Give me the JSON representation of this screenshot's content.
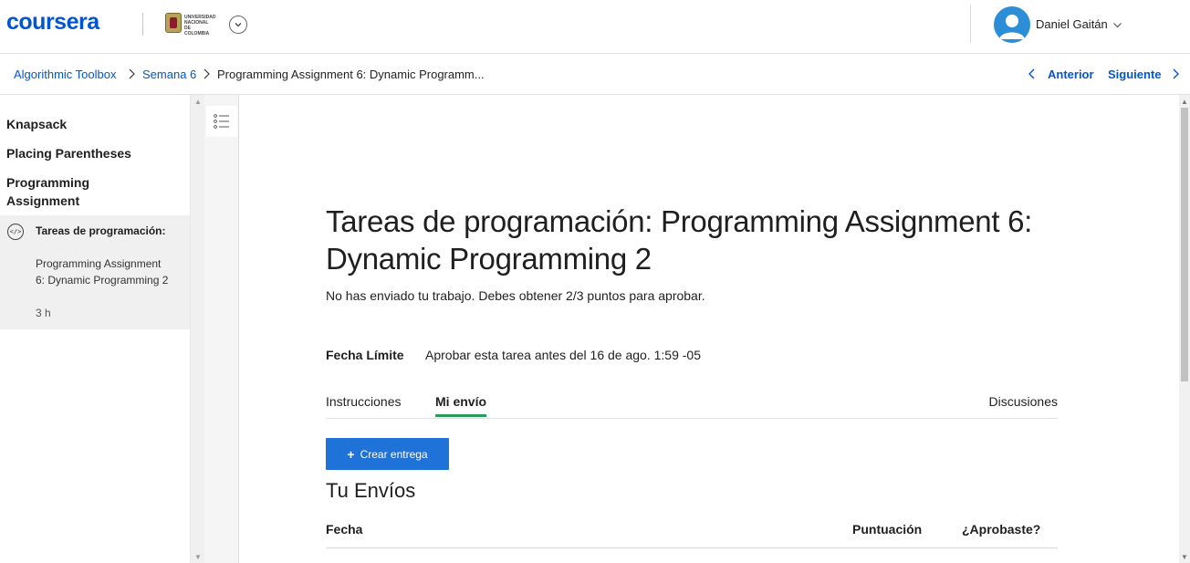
{
  "header": {
    "logo": "coursera",
    "university_logo_text": "UNIVERSIDAD NACIONAL DE COLOMBIA",
    "user_name": "Daniel Gaitán"
  },
  "breadcrumb": {
    "items": [
      "Algorithmic Toolbox",
      "Semana 6",
      "Programming Assignment 6: Dynamic Programm..."
    ],
    "prev_label": "Anterior",
    "next_label": "Siguiente"
  },
  "sidebar": {
    "headings": [
      "Knapsack",
      "Placing Parentheses",
      "Programming Assignment"
    ],
    "active_item": {
      "icon": "code-icon",
      "title": "Tareas de programación:",
      "subtitle": "Programming Assignment 6: Dynamic Programming 2",
      "duration": "3 h"
    }
  },
  "main": {
    "title": "Tareas de programación: Programming Assignment 6: Dynamic Programming 2",
    "subtitle": "No has enviado tu trabajo. Debes obtener 2/3 puntos para aprobar.",
    "deadline_label": "Fecha Límite",
    "deadline_value": "Aprobar esta tarea antes del 16 de ago. 1:59 -05",
    "tabs": [
      {
        "label": "Instrucciones",
        "active": false
      },
      {
        "label": "Mi envío",
        "active": true
      },
      {
        "label": "Discusiones",
        "active": false
      }
    ],
    "create_button": "Crear entrega",
    "section_title": "Tu Envíos",
    "table_headers": [
      "Fecha",
      "Puntuación",
      "¿Aprobaste?"
    ]
  },
  "colors": {
    "brand": "#0056d2",
    "button": "#1f72d8",
    "active_tab": "#2a9d5c"
  }
}
